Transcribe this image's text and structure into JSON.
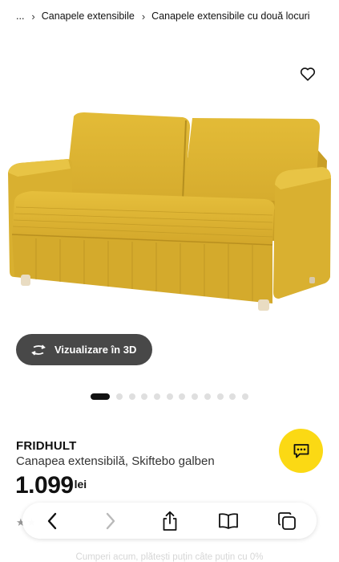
{
  "breadcrumb": {
    "ellipsis": "...",
    "items": [
      "Canapele extensibile",
      "Canapele extensibile cu două locuri"
    ]
  },
  "product": {
    "image_alt": "Canapea extensibilă galbenă cu două locuri",
    "color": "#dcb332",
    "brand": "FRIDHULT",
    "description": "Canapea extensibilă, Skiftebo galben",
    "price": "1.099",
    "currency": "lei"
  },
  "view3d": {
    "label": "Vizualizare în 3D",
    "icon": "rotate-3d-icon"
  },
  "carousel": {
    "total": 12,
    "active_index": 0
  },
  "chat": {
    "icon": "chat-icon",
    "color": "#fbd914"
  },
  "toolbar": {
    "buttons": [
      "back-icon",
      "forward-icon",
      "share-icon",
      "bookmarks-icon",
      "tabs-icon"
    ]
  },
  "promo_text": "Cumperi acum, plătești puțin câte puțin cu 0%"
}
